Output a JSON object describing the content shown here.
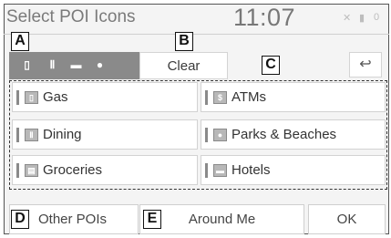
{
  "header": {
    "title": "Select POI Icons",
    "time": "11:07",
    "status_icons": [
      "signal-icon",
      "phone-icon",
      "bluetooth-icon"
    ]
  },
  "callouts": [
    "A",
    "B",
    "C",
    "D",
    "E"
  ],
  "toolbar": {
    "category_icons": [
      "fuel-icon",
      "dining-icon",
      "hotel-icon",
      "parks-icon"
    ],
    "clear_label": "Clear",
    "back_icon": "back-arrow-icon"
  },
  "poi_items": [
    {
      "label": "Gas",
      "icon": "fuel-icon"
    },
    {
      "label": "ATMs",
      "icon": "atm-icon"
    },
    {
      "label": "Dining",
      "icon": "dining-icon"
    },
    {
      "label": "Parks & Beaches",
      "icon": "parks-icon"
    },
    {
      "label": "Groceries",
      "icon": "groceries-icon"
    },
    {
      "label": "Hotels",
      "icon": "hotel-icon"
    }
  ],
  "footer": {
    "other_pois_label": "Other POIs",
    "around_me_label": "Around Me",
    "ok_label": "OK"
  },
  "colors": {
    "background": "#f4f4f4",
    "icon_strip": "#8a8a8a",
    "button": "#ffffff"
  }
}
